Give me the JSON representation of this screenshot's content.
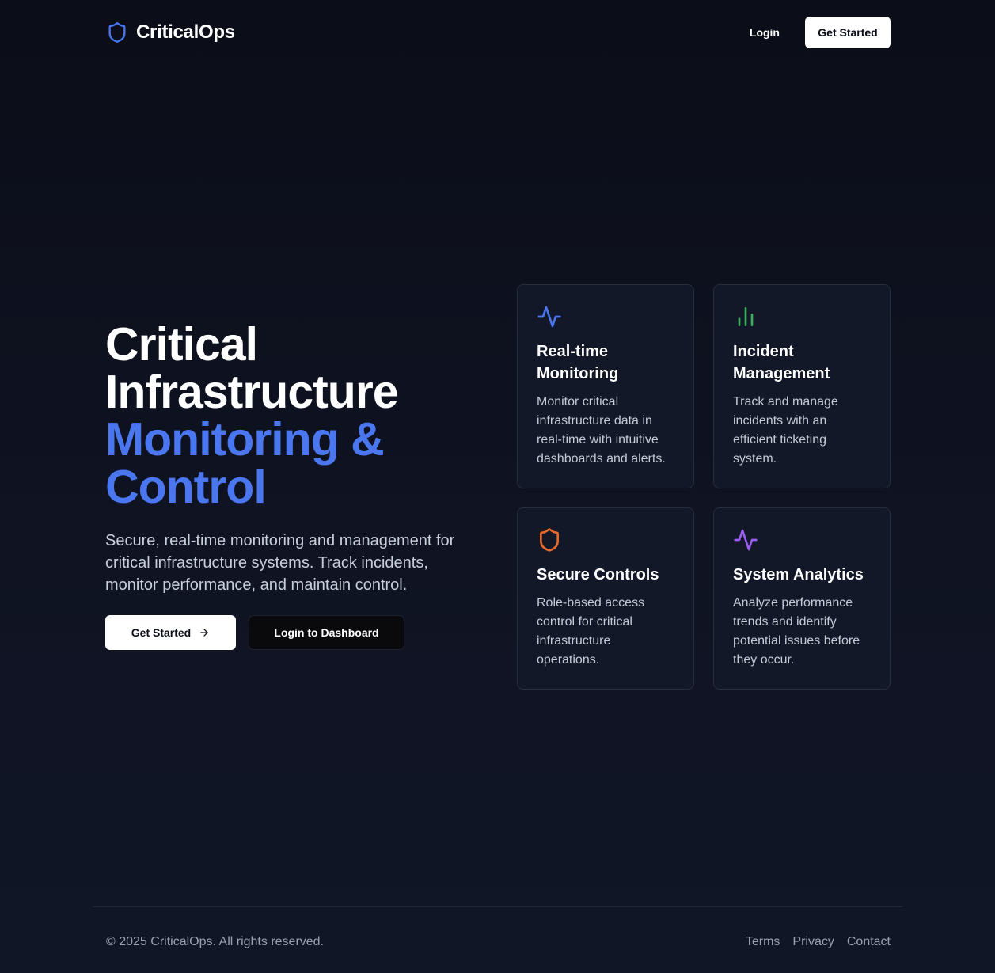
{
  "header": {
    "brand_name": "CriticalOps",
    "login_label": "Login",
    "cta_label": "Get Started"
  },
  "hero": {
    "title_line1": "Critical",
    "title_line2": "Infrastructure",
    "title_line3": "Monitoring &",
    "title_line4": "Control",
    "description": "Secure, real-time monitoring and management for critical infrastructure systems. Track incidents, monitor performance, and maintain control.",
    "primary_button": "Get Started",
    "secondary_button": "Login to Dashboard"
  },
  "features": [
    {
      "title": "Real-time Monitoring",
      "description": "Monitor critical infrastructure data in real-time with intuitive dashboards and alerts.",
      "icon": "activity-icon",
      "icon_color": "#4a77f0"
    },
    {
      "title": "Incident Management",
      "description": "Track and manage incidents with an efficient ticketing system.",
      "icon": "bar-chart-icon",
      "icon_color": "#3fae5c"
    },
    {
      "title": "Secure Controls",
      "description": "Role-based access control for critical infrastructure operations.",
      "icon": "shield-icon",
      "icon_color": "#e86a2a"
    },
    {
      "title": "System Analytics",
      "description": "Analyze performance trends and identify potential issues before they occur.",
      "icon": "activity-icon",
      "icon_color": "#9b5cf0"
    }
  ],
  "footer": {
    "copyright": "© 2025 CriticalOps. All rights reserved.",
    "links": [
      "Terms",
      "Privacy",
      "Contact"
    ]
  },
  "colors": {
    "accent": "#4a77f0",
    "background": "#0f1322",
    "card": "#121827"
  }
}
